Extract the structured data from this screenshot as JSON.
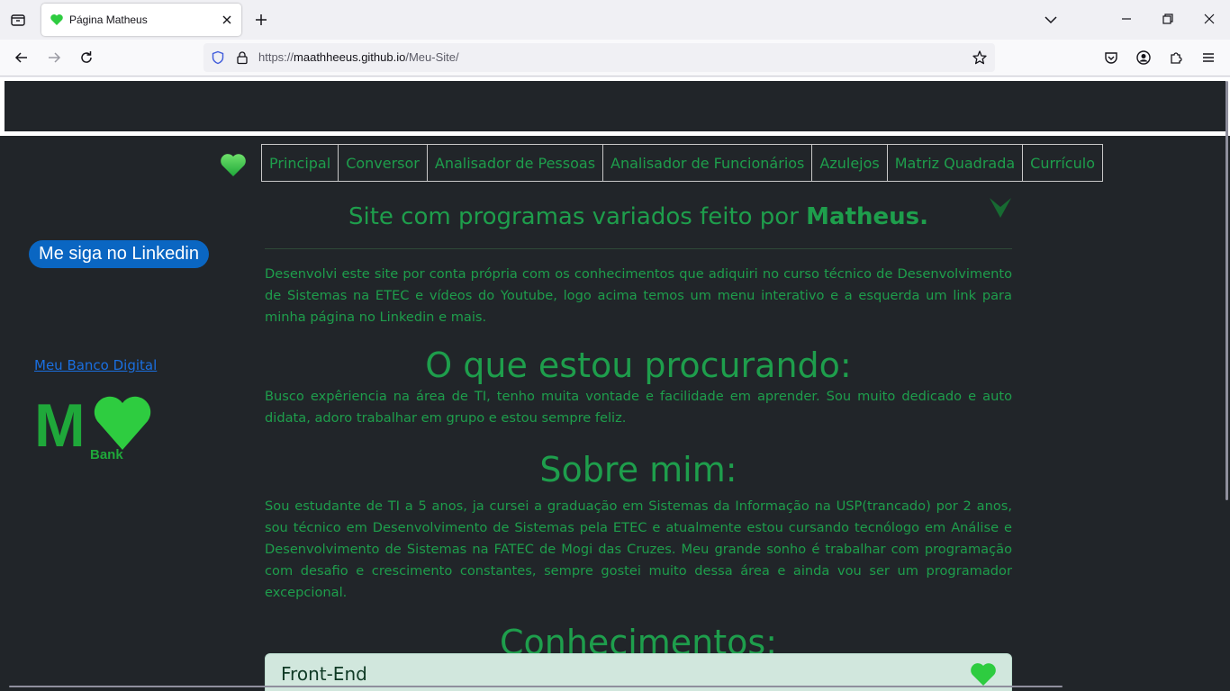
{
  "browser": {
    "tab_title": "Página Matheus",
    "url_prefix": "https://",
    "url_host": "maathheeus.github.io",
    "url_path": "/Meu-Site/"
  },
  "menu": {
    "items": [
      {
        "label": "Principal"
      },
      {
        "label": "Conversor"
      },
      {
        "label": "Analisador de Pessoas"
      },
      {
        "label": "Analisador de Funcionários"
      },
      {
        "label": "Azulejos"
      },
      {
        "label": "Matriz Quadrada"
      },
      {
        "label": "Currículo"
      }
    ]
  },
  "sidebar": {
    "linkedin_label": "Me siga no Linkedin",
    "bank_link": "Meu Banco Digital",
    "bank_logo_letter": "M",
    "bank_logo_text": "Bank"
  },
  "main": {
    "title_prefix": "Site com programas variados feito por ",
    "title_name": "Matheus.",
    "intro": "Desenvolvi este site por conta própria com os conhecimentos que adiquiri no curso técnico de Desenvolvimento de Sistemas na ETEC e vídeos do Youtube, logo acima temos um menu interativo e a esquerda um link para minha página no Linkedin e mais.",
    "procurando_title": "O que estou procurando:",
    "procurando_text": "Busco expêriencia na área de TI, tenho muita vontade e facilidade em aprender. Sou muito dedicado e auto didata, adoro trabalhar em grupo e estou sempre feliz.",
    "sobre_title": "Sobre mim:",
    "sobre_text": "Sou estudante de TI a 5 anos, ja cursei a graduação em Sistemas da Informação na USP(trancado) por 2 anos, sou técnico em Desenvolvimento de Sistemas pela ETEC e atualmente estou cursando tecnólogo em Análise e Desenvolvimento de Sistemas na FATEC de Mogi das Cruzes. Meu grande sonho é trabalhar com programação com desafio e crescimento constantes, sempre gostei muito dessa área e ainda vou ser um programador excepcional.",
    "conhecimentos_title": "Conhecimentos:",
    "card_title": "Front-End"
  },
  "colors": {
    "page_bg": "#212529",
    "accent_green": "#1e9e4c",
    "heart_green": "#2ecc40",
    "linkedin_blue": "#0a66c2",
    "card_bg": "#d1e7dd"
  },
  "icons": [
    "tab-list-icon",
    "heart-favicon-icon",
    "close-icon",
    "plus-icon",
    "chevron-down-icon",
    "minimize-icon",
    "restore-icon",
    "back-icon",
    "forward-icon",
    "reload-icon",
    "shield-icon",
    "lock-icon",
    "star-icon",
    "pocket-icon",
    "account-icon",
    "extensions-icon",
    "menu-icon",
    "heart-icon",
    "bank-logo"
  ]
}
